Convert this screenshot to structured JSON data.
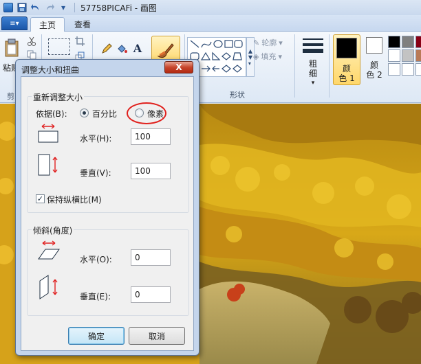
{
  "window": {
    "title": "57758PICAFi - 画图",
    "title_dropdown_glyph": "▾"
  },
  "ribbon_tabs": {
    "app_menu_glyph": "≡▾",
    "tabs": [
      {
        "label": "主页",
        "active": true
      },
      {
        "label": "查看",
        "active": false
      }
    ]
  },
  "ribbon": {
    "paste_label": "粘贴",
    "clipboard_group_label": "剪",
    "shapes_group_label": "形状",
    "outline_label": "轮廓",
    "fill_label": "填充",
    "size_label_line1": "粗",
    "size_label_line2": "细",
    "color1_label_line1": "颜",
    "color1_label_line2": "色 1",
    "color2_label_line1": "颜",
    "color2_label_line2": "色 2",
    "text_tool_glyph": "A",
    "color1_value": "#000000",
    "color2_value": "#ffffff",
    "palette_colors": [
      "#000000",
      "#7f7f7f",
      "#880015",
      "#ffffff",
      "#c3c3c3",
      "#b97a57",
      "#ffffff",
      "#ffffff",
      "#ffffff"
    ]
  },
  "dialog": {
    "title": "调整大小和扭曲",
    "close_glyph": "X",
    "resize": {
      "legend": "重新调整大小",
      "by_label": "依据(B):",
      "option_percent": "百分比",
      "option_pixels": "像素",
      "selected": "percent",
      "horizontal_label": "水平(H):",
      "horizontal_value": "100",
      "vertical_label": "垂直(V):",
      "vertical_value": "100",
      "keep_aspect_label": "保持纵横比(M)",
      "keep_aspect_checked": true,
      "check_glyph": "✓"
    },
    "skew": {
      "legend": "倾斜(角度)",
      "horizontal_label": "水平(O):",
      "horizontal_value": "0",
      "vertical_label": "垂直(E):",
      "vertical_value": "0"
    },
    "ok_label": "确定",
    "cancel_label": "取消"
  }
}
